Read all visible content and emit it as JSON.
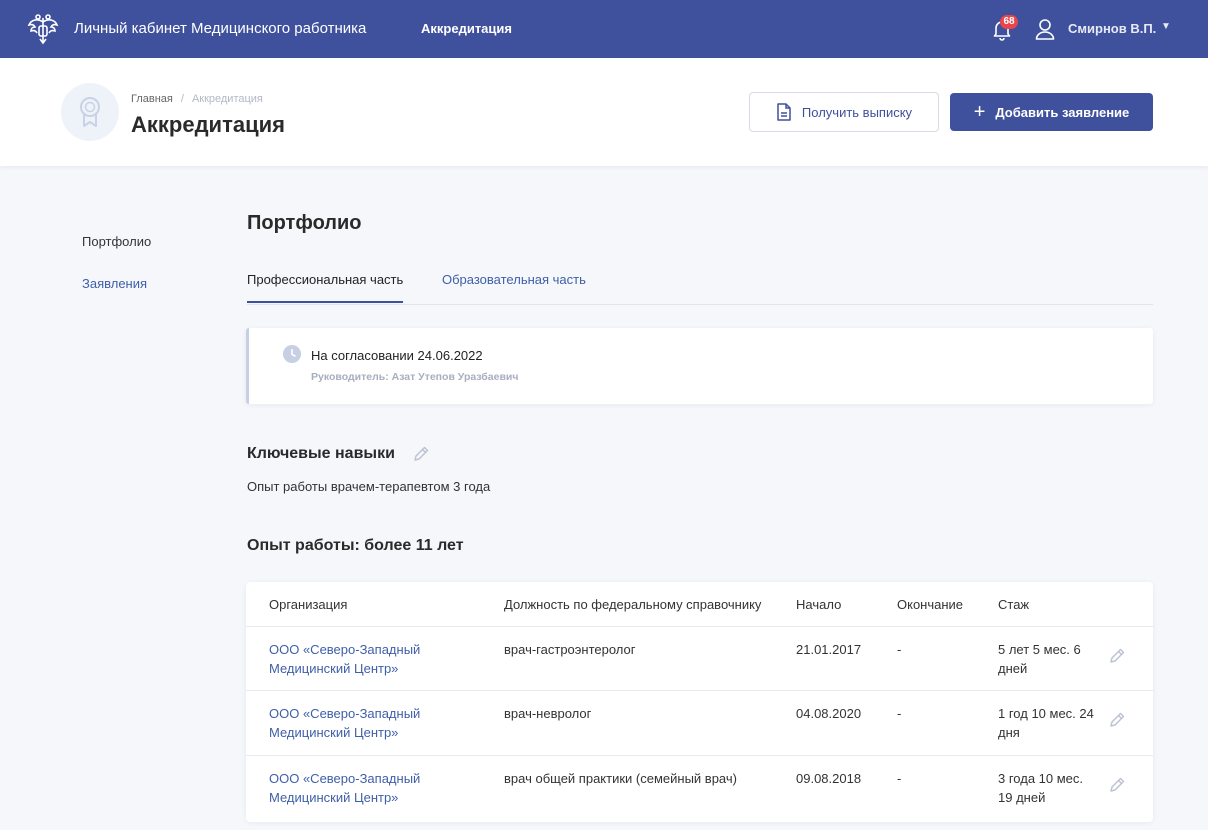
{
  "topbar": {
    "app_title": "Личный кабинет Медицинского работника",
    "nav_item": "Аккредитация",
    "notification_count": "68",
    "user_name": "Смирнов В.П.",
    "caret": "▼",
    "icons": {
      "emblem": "double-headed-eagle-emblem",
      "bell": "bell-icon",
      "user": "user-icon",
      "caret": "chevron-down-icon"
    },
    "colors": {
      "background": "#3f519d",
      "badge": "#e5474c"
    }
  },
  "header": {
    "breadcrumb": {
      "home": "Главная",
      "separator": "/",
      "current": "Аккредитация"
    },
    "title": "Аккредитация",
    "get_extract_button": "Получить выписку",
    "add_application_button": "Добавить заявление",
    "add_icon": "+",
    "icons": {
      "badge": "award-medal-icon",
      "extract": "document-icon",
      "add": "plus-icon"
    }
  },
  "sidebar": {
    "items": [
      {
        "label": "Портфолио"
      },
      {
        "label": "Заявления"
      }
    ]
  },
  "main": {
    "section_title": "Портфолио",
    "tabs": [
      {
        "label": "Профессиональная часть",
        "active": true
      },
      {
        "label": "Образовательная часть",
        "active": false
      }
    ],
    "status_card": {
      "status": "На согласовании 24.06.2022",
      "manager": "Руководитель: Азат Утепов Уразбаевич",
      "icon": "clock-icon"
    },
    "skills": {
      "title": "Ключевые навыки",
      "text": "Опыт работы врачем-терапевтом 3 года",
      "edit_icon": "pencil-icon"
    },
    "experience": {
      "title": "Опыт работы: более 11 лет",
      "columns": [
        "Организация",
        "Должность по федеральному справочнику",
        "Начало",
        "Окончание",
        "Стаж"
      ],
      "rows": [
        {
          "organization": "ООО «Северо-Западный Медицинский Центр»",
          "position": "врач-гастроэнтеролог",
          "start": "21.01.2017",
          "end": "-",
          "tenure": "5 лет 5 мес. 6 дней"
        },
        {
          "organization": "ООО «Северо-Западный Медицинский Центр»",
          "position": "врач-невролог",
          "start": "04.08.2020",
          "end": "-",
          "tenure": "1 год 10 мес. 24 дня"
        },
        {
          "organization": "ООО «Северо-Западный Медицинский Центр»",
          "position": "врач общей практики (семейный врач)",
          "start": "09.08.2018",
          "end": "-",
          "tenure": "3 года 10 мес. 19 дней"
        }
      ]
    }
  }
}
